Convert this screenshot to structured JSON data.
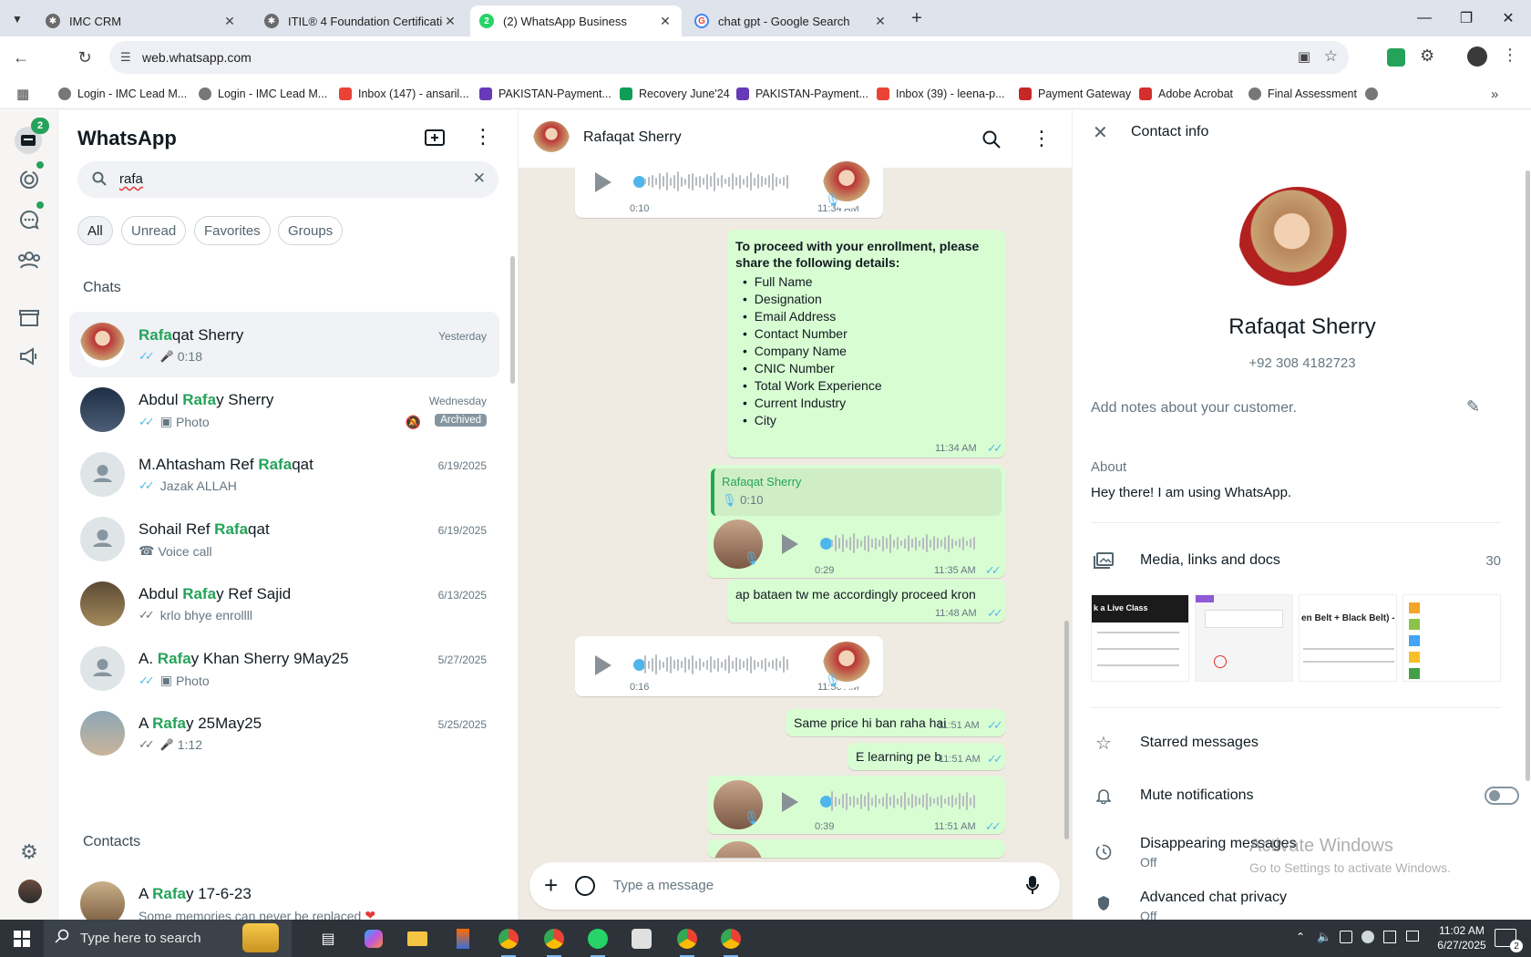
{
  "browser": {
    "tabs": [
      {
        "title": "IMC CRM"
      },
      {
        "title": "ITIL® 4 Foundation Certification"
      },
      {
        "title": "(2) WhatsApp Business",
        "badge": "2"
      },
      {
        "title": "chat gpt - Google Search"
      }
    ],
    "url": "web.whatsapp.com",
    "bookmarks": [
      {
        "label": "Login - IMC Lead M..."
      },
      {
        "label": "Login - IMC Lead M..."
      },
      {
        "label": "Inbox (147) - ansaril..."
      },
      {
        "label": "PAKISTAN-Payment..."
      },
      {
        "label": "Recovery June'24"
      },
      {
        "label": "PAKISTAN-Payment..."
      },
      {
        "label": "Inbox (39) - leena-p..."
      },
      {
        "label": "Payment Gateway"
      },
      {
        "label": "Adobe Acrobat"
      },
      {
        "label": "Final Assessment"
      }
    ]
  },
  "rail": {
    "chats_badge": "2"
  },
  "sidebar": {
    "title": "WhatsApp",
    "search_value": "rafa",
    "filters": [
      "All",
      "Unread",
      "Favorites",
      "Groups"
    ],
    "section_chats": "Chats",
    "section_contacts": "Contacts",
    "chats": [
      {
        "pre": "",
        "hl": "Rafa",
        "post": "qat Sherry",
        "date": "Yesterday",
        "preview": "0:18",
        "ptype": "voice",
        "ticks": "blue"
      },
      {
        "pre": "Abdul ",
        "hl": "Rafa",
        "post": "y Sherry",
        "date": "Wednesday",
        "preview": "Photo",
        "ptype": "photo",
        "ticks": "blue",
        "badge": "Archived"
      },
      {
        "pre": "M.Ahtasham Ref ",
        "hl": "Rafa",
        "post": "qat",
        "date": "6/19/2025",
        "preview": "Jazak ALLAH",
        "ptype": "text",
        "ticks": "blue"
      },
      {
        "pre": "Sohail Ref ",
        "hl": "Rafa",
        "post": "qat",
        "date": "6/19/2025",
        "preview": "Voice call",
        "ptype": "call",
        "ticks": "none"
      },
      {
        "pre": "Abdul ",
        "hl": "Rafa",
        "post": "y Ref Sajid",
        "date": "6/13/2025",
        "preview": "krlo bhye enrollll",
        "ptype": "text",
        "ticks": "grey"
      },
      {
        "pre": "A. ",
        "hl": "Rafa",
        "post": "y Khan Sherry 9May25",
        "date": "5/27/2025",
        "preview": "Photo",
        "ptype": "photo",
        "ticks": "blue"
      },
      {
        "pre": "A ",
        "hl": "Rafa",
        "post": "y 25May25",
        "date": "5/25/2025",
        "preview": "1:12",
        "ptype": "voice",
        "ticks": "grey"
      }
    ],
    "contact": {
      "pre": "A ",
      "hl": "Rafa",
      "post": "y 17-6-23",
      "preview": "Some memories can never be replaced"
    }
  },
  "conversation": {
    "contact_name": "Rafaqat Sherry",
    "messages": {
      "voice1": {
        "duration": "0:10",
        "time": "11:34 AM"
      },
      "enroll": {
        "heading": "To proceed with your enrollment, please share the following details:",
        "items": [
          "Full Name",
          "Designation",
          "Email Address",
          "Contact Number",
          "Company Name",
          "CNIC Number",
          "Total Work Experience",
          "Current Industry",
          "City"
        ],
        "time": "11:34 AM"
      },
      "reply": {
        "quote_author": "Rafaqat Sherry",
        "quote_duration": "0:10",
        "duration": "0:29",
        "time": "11:35 AM"
      },
      "text1": {
        "text": "ap bataen tw me accordingly proceed kron",
        "time": "11:48 AM"
      },
      "voice2": {
        "duration": "0:16",
        "time": "11:50 AM"
      },
      "text2": {
        "text": "Same price hi ban raha hai",
        "time": "11:51 AM"
      },
      "text3": {
        "text": "E learning pe b",
        "time": "11:51 AM"
      },
      "voice3": {
        "duration": "0:39",
        "time": "11:51 AM"
      }
    },
    "composer_placeholder": "Type a message"
  },
  "contact_info": {
    "header": "Contact info",
    "name": "Rafaqat Sherry",
    "phone": "+92 308 4182723",
    "notes_placeholder": "Add notes about your customer.",
    "about_label": "About",
    "about_text": "Hey there! I am using WhatsApp.",
    "media_label": "Media, links and docs",
    "media_count": "30",
    "media_thumbs": [
      "k a Live Class",
      "",
      "en Belt + Black Belt) - I",
      ""
    ],
    "starred": "Starred messages",
    "mute": "Mute notifications",
    "mute_on": false,
    "disappearing": "Disappearing messages",
    "disappearing_value": "Off",
    "privacy": "Advanced chat privacy",
    "privacy_value": "Off",
    "watermark_title": "Activate Windows",
    "watermark_sub": "Go to Settings to activate Windows."
  },
  "taskbar": {
    "search_placeholder": "Type here to search",
    "time": "11:02 AM",
    "date": "6/27/2025",
    "notif_count": "2"
  },
  "colors": {
    "accent": "#25a35a",
    "bubble_out": "#d9fdd3",
    "chat_bg": "#efeae2",
    "tick_blue": "#53bdeb"
  }
}
